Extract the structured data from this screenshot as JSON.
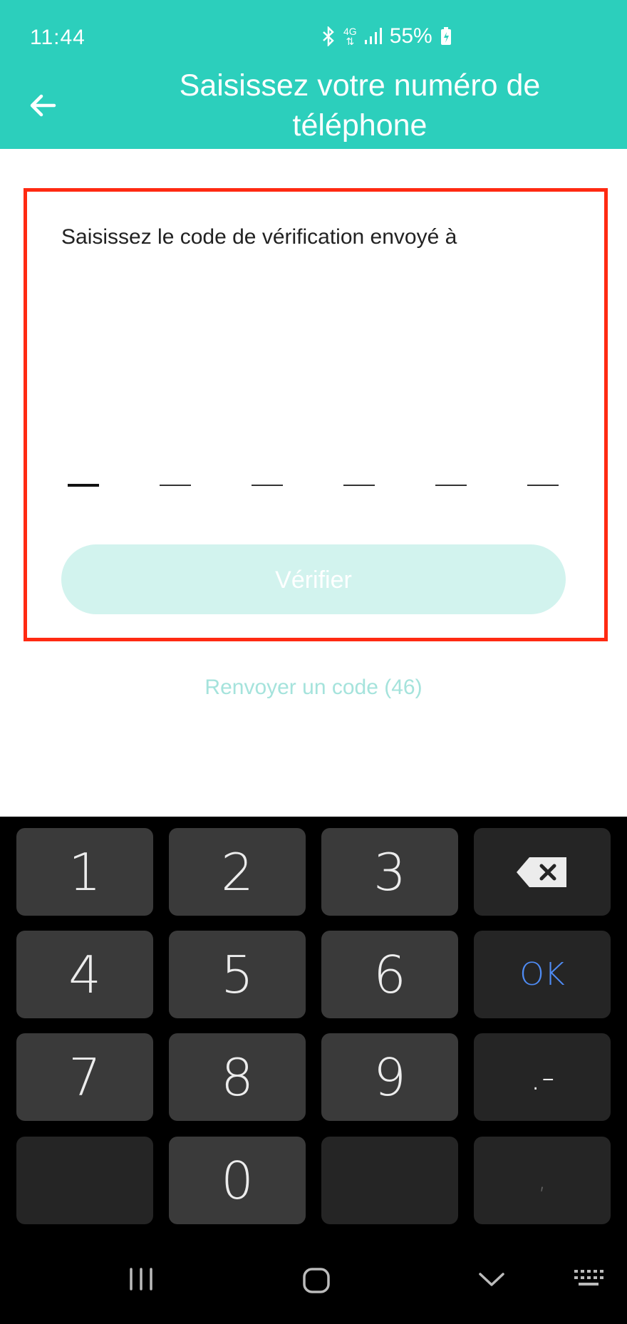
{
  "status_bar": {
    "time": "11:44",
    "network": "4G",
    "battery": "55%"
  },
  "header": {
    "title": "Saisissez votre numéro de téléphone"
  },
  "verification": {
    "prompt": "Saisissez le code de vérification envoyé à",
    "code_length": 6,
    "verify_label": "Vérifier",
    "resend_label": "Renvoyer un code (46)"
  },
  "keyboard": {
    "keys": [
      "1",
      "2",
      "3",
      "4",
      "5",
      "6",
      "7",
      "8",
      "9",
      "0"
    ],
    "ok_label": "OK",
    "symbol_label": ".-",
    "comma_label": ","
  },
  "colors": {
    "accent": "#2ccfbc",
    "highlight_border": "#ff2a12",
    "ok_key": "#4f8cf5"
  }
}
